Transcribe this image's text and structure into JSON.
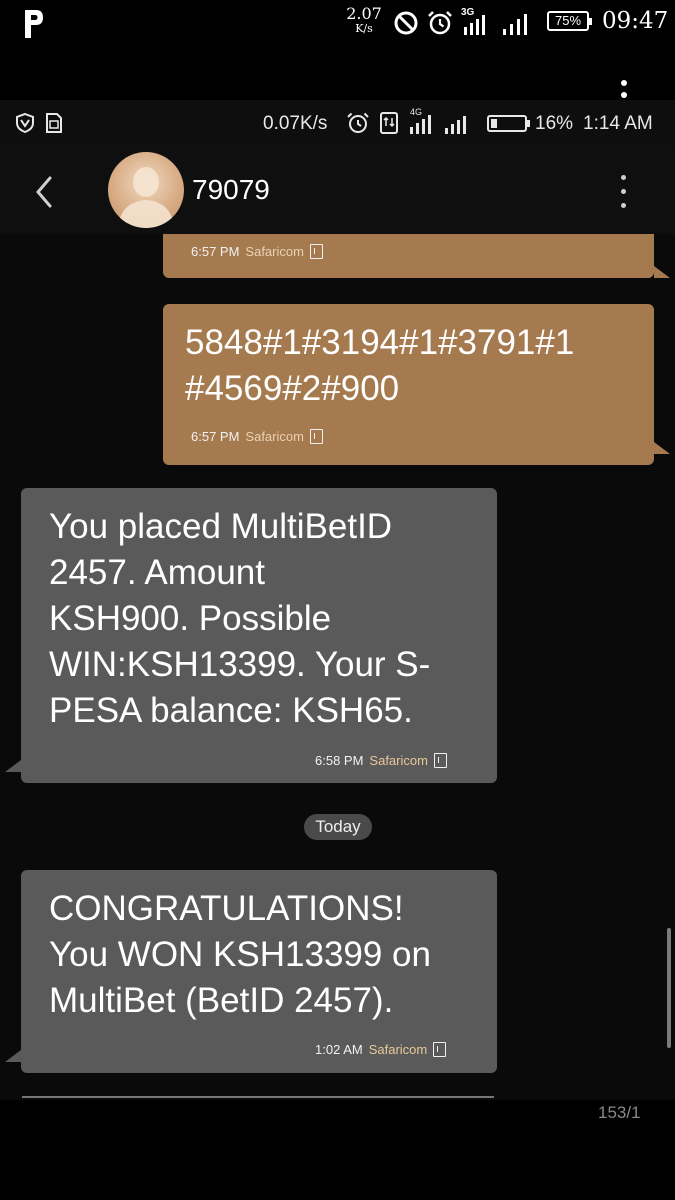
{
  "outer_status": {
    "speed_value": "2.07",
    "speed_unit": "K/s",
    "network_type": "3G",
    "battery": "75%",
    "time": "09:47"
  },
  "inner_status": {
    "speed": "0.07K/s",
    "network_type": "4G",
    "battery": "16%",
    "time": "1:14 AM"
  },
  "header": {
    "contact": "79079"
  },
  "messages": [
    {
      "type": "sent",
      "text": "",
      "time": "6:57 PM",
      "carrier": "Safaricom"
    },
    {
      "type": "sent",
      "text": "5848#1#3194#1#3791#1\n#4569#2#900",
      "time": "6:57 PM",
      "carrier": "Safaricom"
    },
    {
      "type": "received",
      "text": "You placed MultiBetID\n2457. Amount\nKSH900. Possible\nWIN:KSH13399. Your S-\nPESA balance: KSH65.",
      "time": "6:58 PM",
      "carrier": "Safaricom"
    },
    {
      "type": "received",
      "text": "CONGRATULATIONS!\nYou WON KSH13399 on\nMultiBet (BetID 2457).",
      "time": "1:02 AM",
      "carrier": "Safaricom"
    }
  ],
  "date_divider": "Today",
  "char_counter": "153/1",
  "icons": {
    "outer": [
      "app-logo-icon",
      "do-not-disturb-icon",
      "alarm-icon",
      "signal-icon"
    ],
    "inner": [
      "shield-icon",
      "sim-card-icon",
      "alarm-icon",
      "data-transfer-icon",
      "signal-icon",
      "battery-icon"
    ],
    "header": [
      "back-arrow-icon",
      "more-options-icon"
    ]
  },
  "colors": {
    "sent_bubble": "#a57a4f",
    "received_bubble": "#5a5a5a",
    "carrier_label": "#e8c89a"
  }
}
